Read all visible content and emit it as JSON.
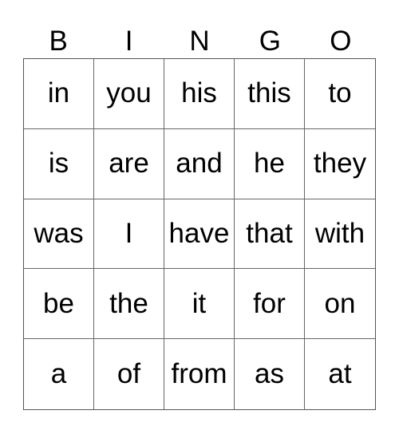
{
  "header": [
    "B",
    "I",
    "N",
    "G",
    "O"
  ],
  "rows": [
    [
      "in",
      "you",
      "his",
      "this",
      "to"
    ],
    [
      "is",
      "are",
      "and",
      "he",
      "they"
    ],
    [
      "was",
      "I",
      "have",
      "that",
      "with"
    ],
    [
      "be",
      "the",
      "it",
      "for",
      "on"
    ],
    [
      "a",
      "of",
      "from",
      "as",
      "at"
    ]
  ]
}
